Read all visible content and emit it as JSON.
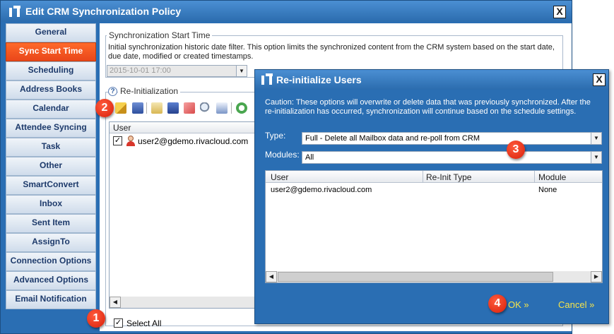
{
  "main_window": {
    "title": "Edit CRM Synchronization Policy",
    "close_glyph": "X"
  },
  "sidebar": {
    "items": [
      {
        "label": "General",
        "active": false
      },
      {
        "label": "Sync Start Time",
        "active": true
      },
      {
        "label": "Scheduling",
        "active": false
      },
      {
        "label": "Address Books",
        "active": false
      },
      {
        "label": "Calendar",
        "active": false
      },
      {
        "label": "Attendee Syncing",
        "active": false
      },
      {
        "label": "Task",
        "active": false
      },
      {
        "label": "Other",
        "active": false
      },
      {
        "label": "SmartConvert",
        "active": false
      },
      {
        "label": "Inbox",
        "active": false
      },
      {
        "label": "Sent Item",
        "active": false
      },
      {
        "label": "AssignTo",
        "active": false
      },
      {
        "label": "Connection Options",
        "active": false
      },
      {
        "label": "Advanced Options",
        "active": false
      },
      {
        "label": "Email Notification",
        "active": false
      }
    ]
  },
  "sync_start": {
    "group_label": "Synchronization Start Time",
    "description": "Initial synchronization historic date filter.  This option limits the synchronized content from the CRM system based on the start date, due date, modified or created timestamps.",
    "date_value": "2015-10-01 17:00"
  },
  "reinit": {
    "group_label": "Re-Initialization",
    "toolbar_icons": [
      "edit-icon",
      "copy-icon",
      "notes-icon",
      "save-icon",
      "eraser-icon",
      "search-icon",
      "export-icon",
      "refresh-icon"
    ],
    "grid_header": "User",
    "rows": [
      {
        "user": "user2@gdemo.rivacloud.com",
        "checked": true
      }
    ],
    "select_all_label": "Select All",
    "select_all_checked": true
  },
  "dialog": {
    "title": "Re-initialize Users",
    "close_glyph": "X",
    "caution": "Caution: These options will overwrite or delete data that was previously synchronized.  After the re-initialization has occurred, synchronization will continue based on the schedule settings.",
    "type_label": "Type:",
    "type_value": "Full - Delete all Mailbox data and re-poll from CRM",
    "modules_label": "Modules:",
    "modules_value": "All",
    "columns": [
      "User",
      "Re-Init Type",
      "Module"
    ],
    "rows": [
      {
        "user": "user2@gdemo.rivacloud.com",
        "reinit_type": "",
        "module": "None"
      }
    ],
    "ok_label": "OK »",
    "cancel_label": "Cancel »"
  },
  "callouts": [
    "1",
    "2",
    "3",
    "4"
  ],
  "colors": {
    "window_blue": "#2a6eb3",
    "active_orange": "#f0521f",
    "callout_red": "#e0261a",
    "button_yellow": "#f7e44a"
  }
}
